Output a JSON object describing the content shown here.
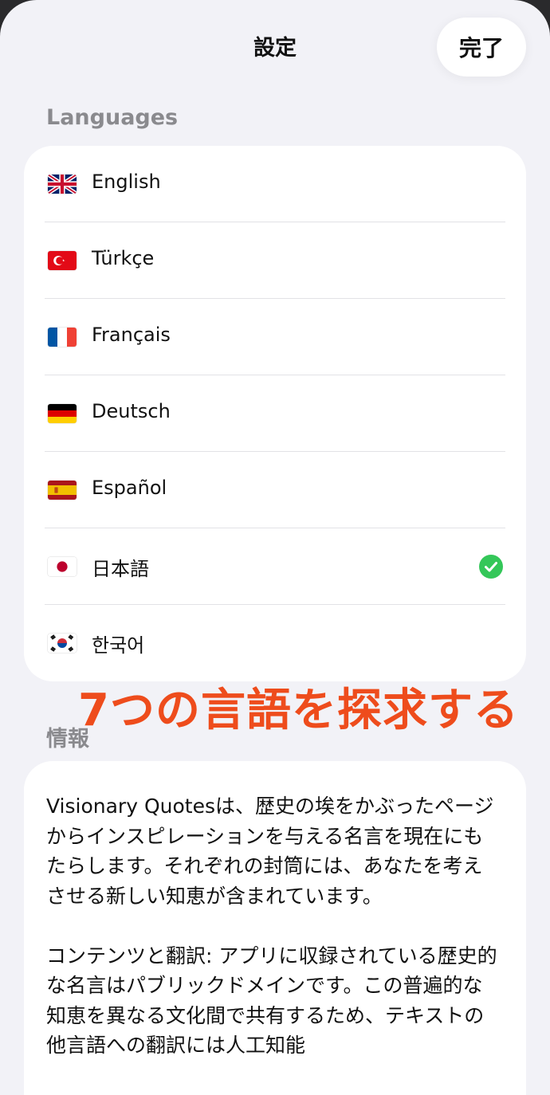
{
  "nav": {
    "title": "設定",
    "done_label": "完了"
  },
  "languages": {
    "header": "Languages",
    "items": [
      {
        "label": "English",
        "flag": "uk-flag-icon",
        "selected": false
      },
      {
        "label": "Türkçe",
        "flag": "turkey-flag-icon",
        "selected": false
      },
      {
        "label": "Français",
        "flag": "france-flag-icon",
        "selected": false
      },
      {
        "label": "Deutsch",
        "flag": "germany-flag-icon",
        "selected": false
      },
      {
        "label": "Español",
        "flag": "spain-flag-icon",
        "selected": false
      },
      {
        "label": "日本語",
        "flag": "japan-flag-icon",
        "selected": true
      },
      {
        "label": "한국어",
        "flag": "korea-flag-icon",
        "selected": false
      }
    ],
    "check_color": "#34c759"
  },
  "overlay": {
    "text": "7つの言語を探求する",
    "color": "#ee4c1c"
  },
  "info": {
    "header": "情報",
    "paragraph1": "Visionary Quotesは、歴史の埃をかぶったページからインスピレーションを与える名言を現在にもたらします。それぞれの封筒には、あなたを考えさせる新しい知恵が含まれています。",
    "paragraph2": "コンテンツと翻訳: アプリに収録されている歴史的な名言はパブリックドメインです。この普遍的な知恵を異なる文化間で共有するため、テキストの他言語への翻訳には人工知能"
  }
}
